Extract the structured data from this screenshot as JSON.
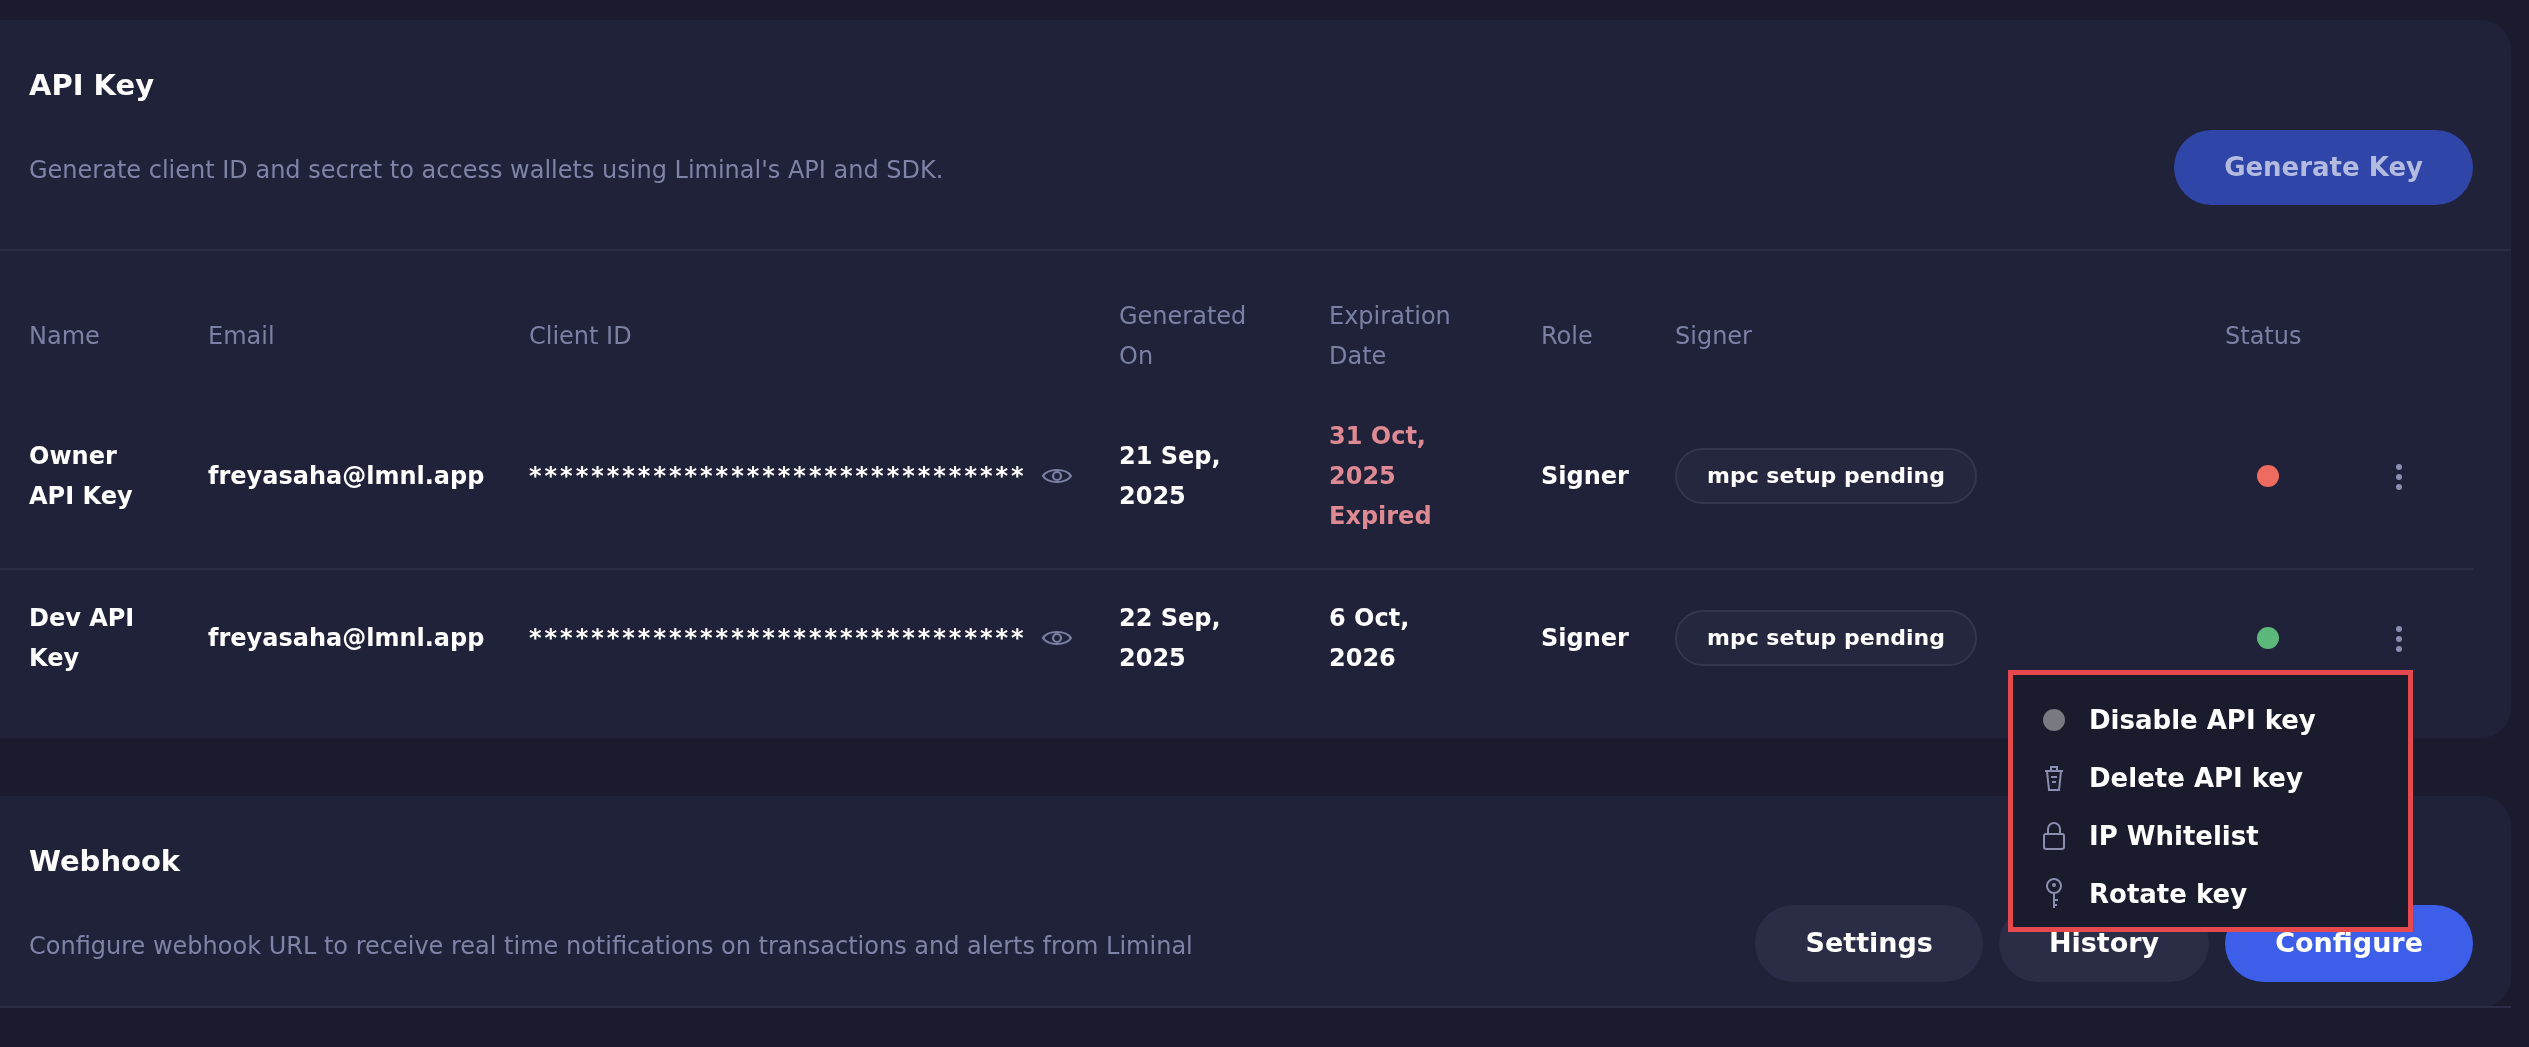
{
  "api_key": {
    "title": "API Key",
    "description": "Generate client ID and secret to access wallets using Liminal's API and SDK.",
    "generate_button": "Generate Key",
    "columns": [
      "Name",
      "Email",
      "Client ID",
      "Generated On",
      "Expiration Date",
      "Role",
      "Signer",
      "Status"
    ],
    "rows": [
      {
        "name": "Owner API Key",
        "email": "freyasaha@lmnl.app",
        "client_id": "********************************",
        "generated_on": "21 Sep, 2025",
        "expiration_date": "31 Oct, 2025",
        "expired": true,
        "expired_label": "Expired",
        "role": "Signer",
        "signer": "mpc setup pending",
        "color": "#ee6b60"
      },
      {
        "name": "Dev API Key",
        "email": "freyasaha@lmnl.app",
        "client_id": "********************************",
        "generated_on": "22 Sep, 2025",
        "expiration_date": "6 Oct, 2026",
        "expired": false,
        "role": "Signer",
        "signer": "mpc setup pending",
        "color": "#5cb87a"
      }
    ]
  },
  "actions_menu": {
    "items": [
      {
        "kind": "disable",
        "label": "Disable API key"
      },
      {
        "kind": "delete",
        "label": "Delete API key"
      },
      {
        "kind": "whitelist",
        "label": "IP Whitelist"
      },
      {
        "kind": "rotate",
        "label": "Rotate key"
      }
    ]
  },
  "webhook": {
    "title": "Webhook",
    "description": "Configure webhook URL to receive real time notifications on transactions and alerts from Liminal",
    "buttons": [
      {
        "kind": "secondary",
        "label": "Settings"
      },
      {
        "kind": "secondary",
        "label": "History"
      },
      {
        "kind": "primary",
        "label": "Configure"
      }
    ]
  }
}
